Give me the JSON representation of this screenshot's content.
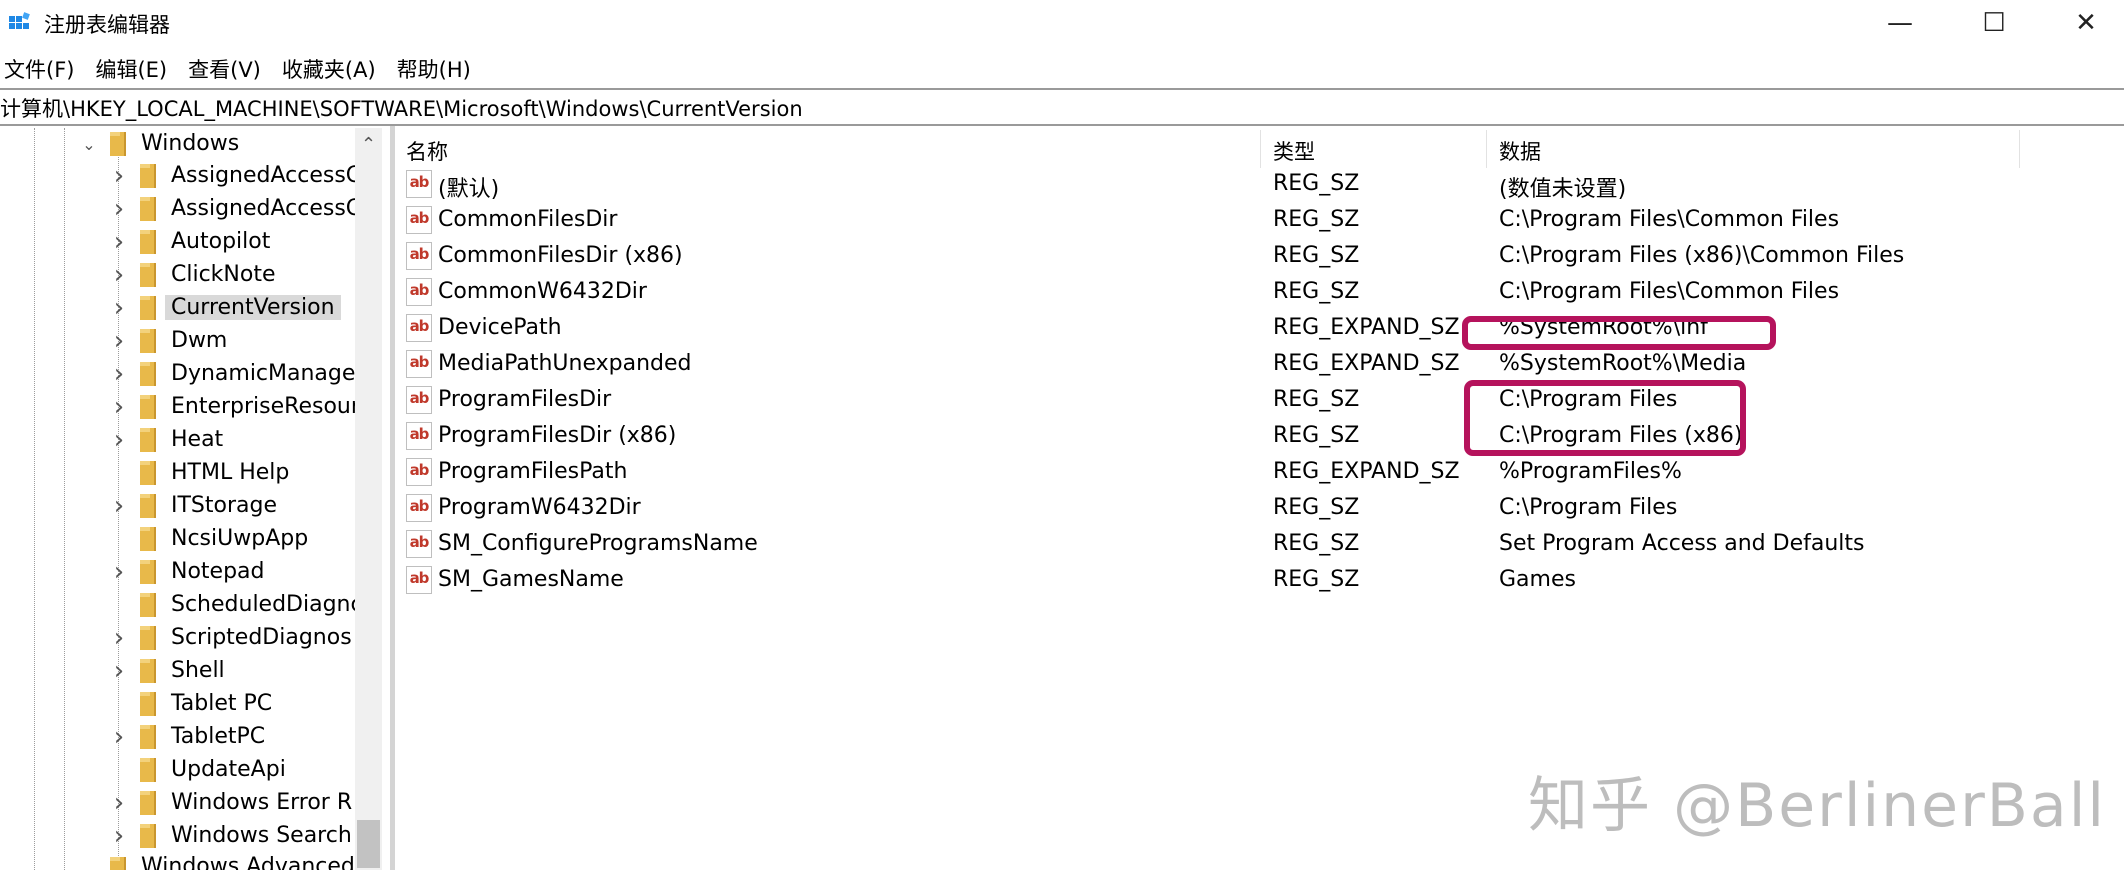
{
  "window": {
    "title": "注册表编辑器",
    "minimize": "—",
    "maximize": "☐",
    "close": "✕"
  },
  "menu": [
    "文件(F)",
    "编辑(E)",
    "查看(V)",
    "收藏夹(A)",
    "帮助(H)"
  ],
  "address": "计算机\\HKEY_LOCAL_MACHINE\\SOFTWARE\\Microsoft\\Windows\\CurrentVersion",
  "tree": {
    "parent": "Windows",
    "items": [
      {
        "label": "AssignedAccessC",
        "expandable": true
      },
      {
        "label": "AssignedAccessC",
        "expandable": true
      },
      {
        "label": "Autopilot",
        "expandable": true
      },
      {
        "label": "ClickNote",
        "expandable": true
      },
      {
        "label": "CurrentVersion",
        "expandable": true,
        "selected": true
      },
      {
        "label": "Dwm",
        "expandable": true
      },
      {
        "label": "DynamicManage",
        "expandable": true
      },
      {
        "label": "EnterpriseResour",
        "expandable": true
      },
      {
        "label": "Heat",
        "expandable": true
      },
      {
        "label": "HTML Help",
        "expandable": false
      },
      {
        "label": "ITStorage",
        "expandable": true
      },
      {
        "label": "NcsiUwpApp",
        "expandable": false
      },
      {
        "label": "Notepad",
        "expandable": true
      },
      {
        "label": "ScheduledDiagnc",
        "expandable": false
      },
      {
        "label": "ScriptedDiagnos",
        "expandable": true
      },
      {
        "label": "Shell",
        "expandable": true
      },
      {
        "label": "Tablet PC",
        "expandable": false
      },
      {
        "label": "TabletPC",
        "expandable": true
      },
      {
        "label": "UpdateApi",
        "expandable": false
      },
      {
        "label": "Windows Error R",
        "expandable": true
      },
      {
        "label": "Windows Search",
        "expandable": true
      }
    ],
    "partial_next": "Windows Advanced"
  },
  "list": {
    "columns": {
      "name": "名称",
      "type": "类型",
      "data": "数据"
    },
    "icon_text": "ab",
    "rows": [
      {
        "name": "(默认)",
        "type": "REG_SZ",
        "data": "(数值未设置)"
      },
      {
        "name": "CommonFilesDir",
        "type": "REG_SZ",
        "data": "C:\\Program Files\\Common Files"
      },
      {
        "name": "CommonFilesDir (x86)",
        "type": "REG_SZ",
        "data": "C:\\Program Files (x86)\\Common Files"
      },
      {
        "name": "CommonW6432Dir",
        "type": "REG_SZ",
        "data": "C:\\Program Files\\Common Files"
      },
      {
        "name": "DevicePath",
        "type": "REG_EXPAND_SZ",
        "data": "%SystemRoot%\\inf"
      },
      {
        "name": "MediaPathUnexpanded",
        "type": "REG_EXPAND_SZ",
        "data": "%SystemRoot%\\Media"
      },
      {
        "name": "ProgramFilesDir",
        "type": "REG_SZ",
        "data": "C:\\Program Files"
      },
      {
        "name": "ProgramFilesDir (x86)",
        "type": "REG_SZ",
        "data": "C:\\Program Files (x86)"
      },
      {
        "name": "ProgramFilesPath",
        "type": "REG_EXPAND_SZ",
        "data": "%ProgramFiles%"
      },
      {
        "name": "ProgramW6432Dir",
        "type": "REG_SZ",
        "data": "C:\\Program Files"
      },
      {
        "name": "SM_ConfigureProgramsName",
        "type": "REG_SZ",
        "data": "Set Program Access and Defaults"
      },
      {
        "name": "SM_GamesName",
        "type": "REG_SZ",
        "data": "Games"
      }
    ]
  },
  "annotations": {
    "highlight_color": "#b5135c"
  },
  "watermark": "知乎 @BerlinerBall"
}
